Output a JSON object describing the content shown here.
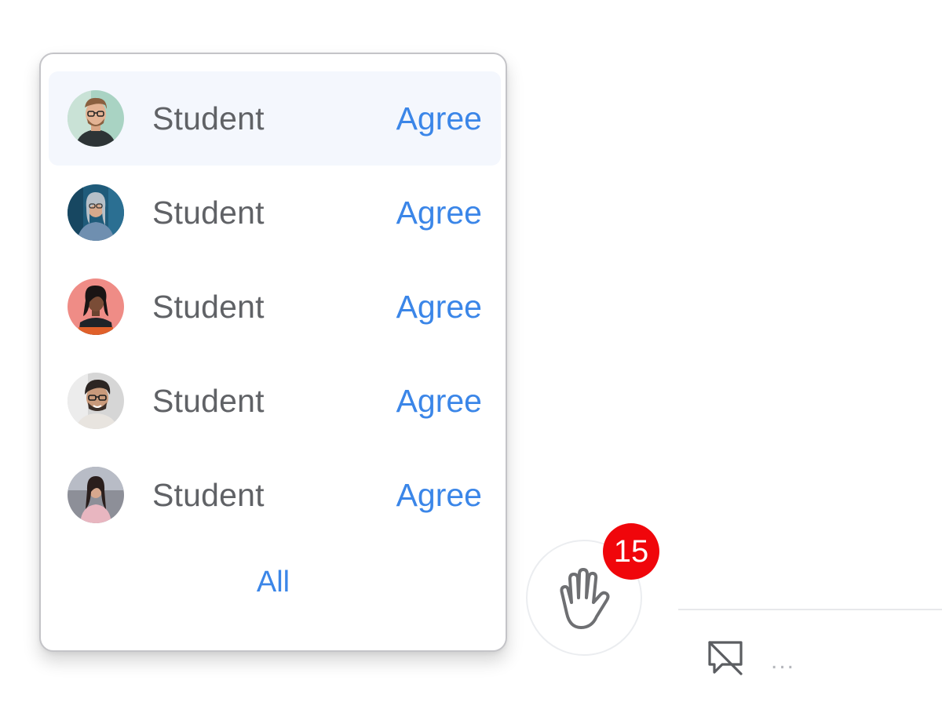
{
  "raise_hand_popup": {
    "items": [
      {
        "name": "Student",
        "action": "Agree",
        "avatar": "student-avatar-1"
      },
      {
        "name": "Student",
        "action": "Agree",
        "avatar": "student-avatar-2"
      },
      {
        "name": "Student",
        "action": "Agree",
        "avatar": "student-avatar-3"
      },
      {
        "name": "Student",
        "action": "Agree",
        "avatar": "student-avatar-4"
      },
      {
        "name": "Student",
        "action": "Agree",
        "avatar": "student-avatar-5"
      }
    ],
    "all_label": "All"
  },
  "raise_hand_button": {
    "icon": "hand-icon",
    "count": "15",
    "badge_color": "#f0060b"
  },
  "toolbar": {
    "danmaku_icon": "comment-off-icon",
    "more_label": "..."
  },
  "colors": {
    "accent": "#3b86e8",
    "text": "#606266",
    "active_row": "#f4f7fd"
  }
}
